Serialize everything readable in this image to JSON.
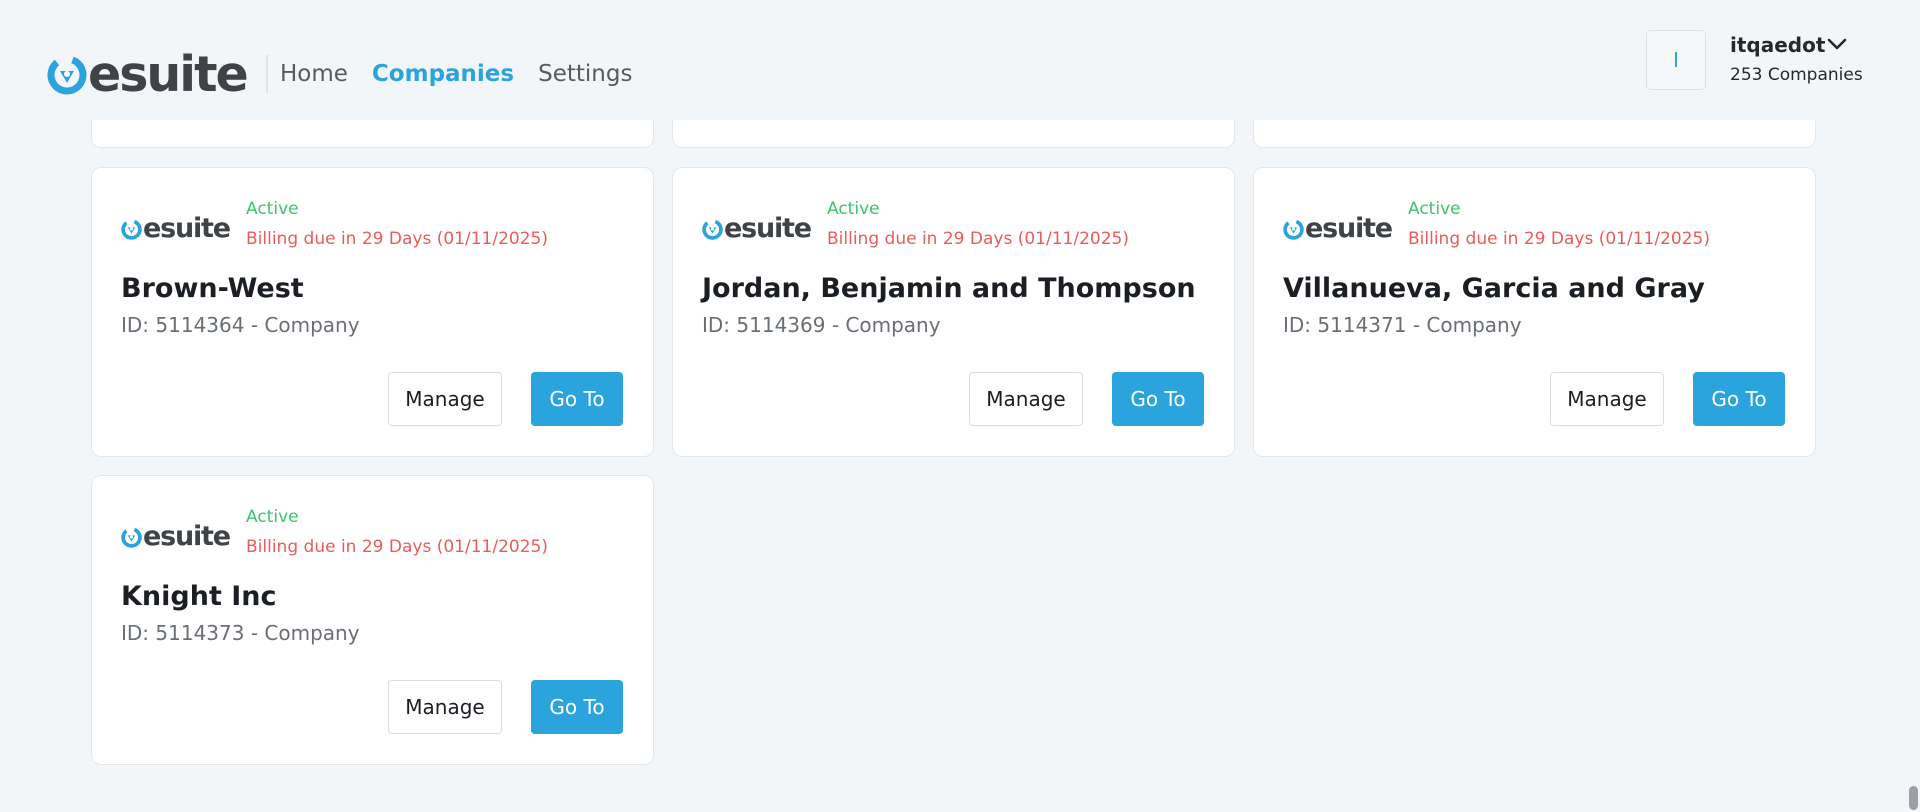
{
  "header": {
    "brand": {
      "prefix": "e",
      "suffix": "suite"
    },
    "nav": [
      {
        "label": "Home",
        "active": false
      },
      {
        "label": "Companies",
        "active": true
      },
      {
        "label": "Settings",
        "active": false
      }
    ],
    "user": {
      "avatar_initial": "I",
      "name": "itqaedot",
      "companies": "253 Companies"
    }
  },
  "colors": {
    "accent": "#2ba3dd",
    "active_status": "#3bc46c",
    "billing_warning": "#ea5c5c",
    "background": "#f3f6f9"
  },
  "companies": [
    {
      "brand": "esuite",
      "status": "Active",
      "billing": "Billing due in 29 Days (01/11/2025)",
      "name": "Brown-West",
      "id_line": "ID: 5114364 - Company",
      "manage_label": "Manage",
      "goto_label": "Go To"
    },
    {
      "brand": "esuite",
      "status": "Active",
      "billing": "Billing due in 29 Days (01/11/2025)",
      "name": "Jordan, Benjamin and Thompson",
      "id_line": "ID: 5114369 - Company",
      "manage_label": "Manage",
      "goto_label": "Go To"
    },
    {
      "brand": "esuite",
      "status": "Active",
      "billing": "Billing due in 29 Days (01/11/2025)",
      "name": "Villanueva, Garcia and Gray",
      "id_line": "ID: 5114371 - Company",
      "manage_label": "Manage",
      "goto_label": "Go To"
    },
    {
      "brand": "esuite",
      "status": "Active",
      "billing": "Billing due in 29 Days (01/11/2025)",
      "name": "Knight Inc",
      "id_line": "ID: 5114373 - Company",
      "manage_label": "Manage",
      "goto_label": "Go To"
    }
  ]
}
